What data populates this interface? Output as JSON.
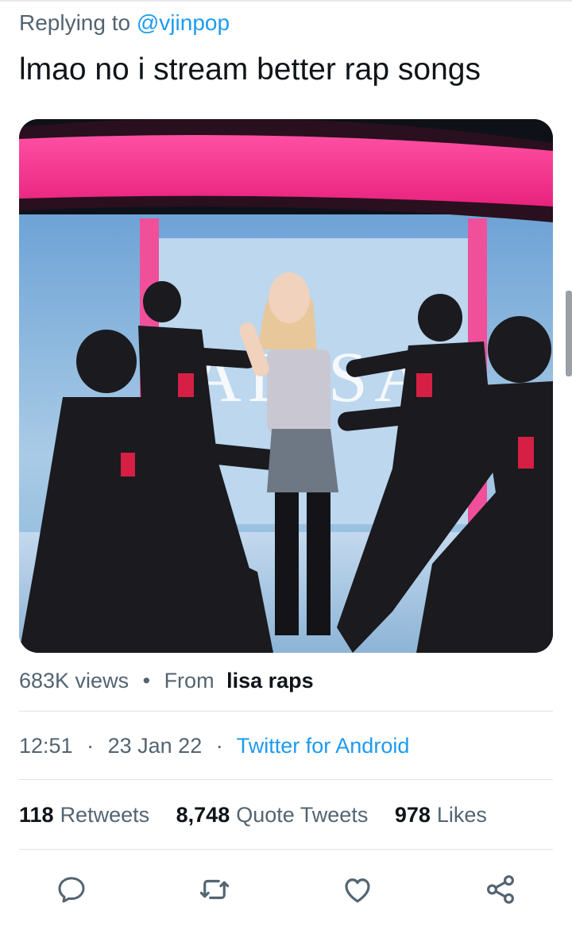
{
  "reply": {
    "prefix": "Replying to",
    "handle": "@vjinpop"
  },
  "tweet": {
    "text": "lmao no i stream better rap songs"
  },
  "media": {
    "kind": "video",
    "stage_text": "LALISA"
  },
  "views": {
    "count": "683K views",
    "separator": "•",
    "from_label": "From",
    "source": "lisa raps"
  },
  "meta": {
    "time": "12:51",
    "date": "23 Jan 22",
    "separator": "·",
    "client": "Twitter for Android"
  },
  "stats": [
    {
      "number": "118",
      "label": "Retweets"
    },
    {
      "number": "8,748",
      "label": "Quote Tweets"
    },
    {
      "number": "978",
      "label": "Likes"
    }
  ],
  "actions": [
    "reply-icon",
    "retweet-icon",
    "like-icon",
    "share-icon"
  ],
  "colors": {
    "accent": "#1d9bf0",
    "secondary_text": "#536471",
    "primary_text": "#0f1419",
    "icon": "#536471"
  }
}
